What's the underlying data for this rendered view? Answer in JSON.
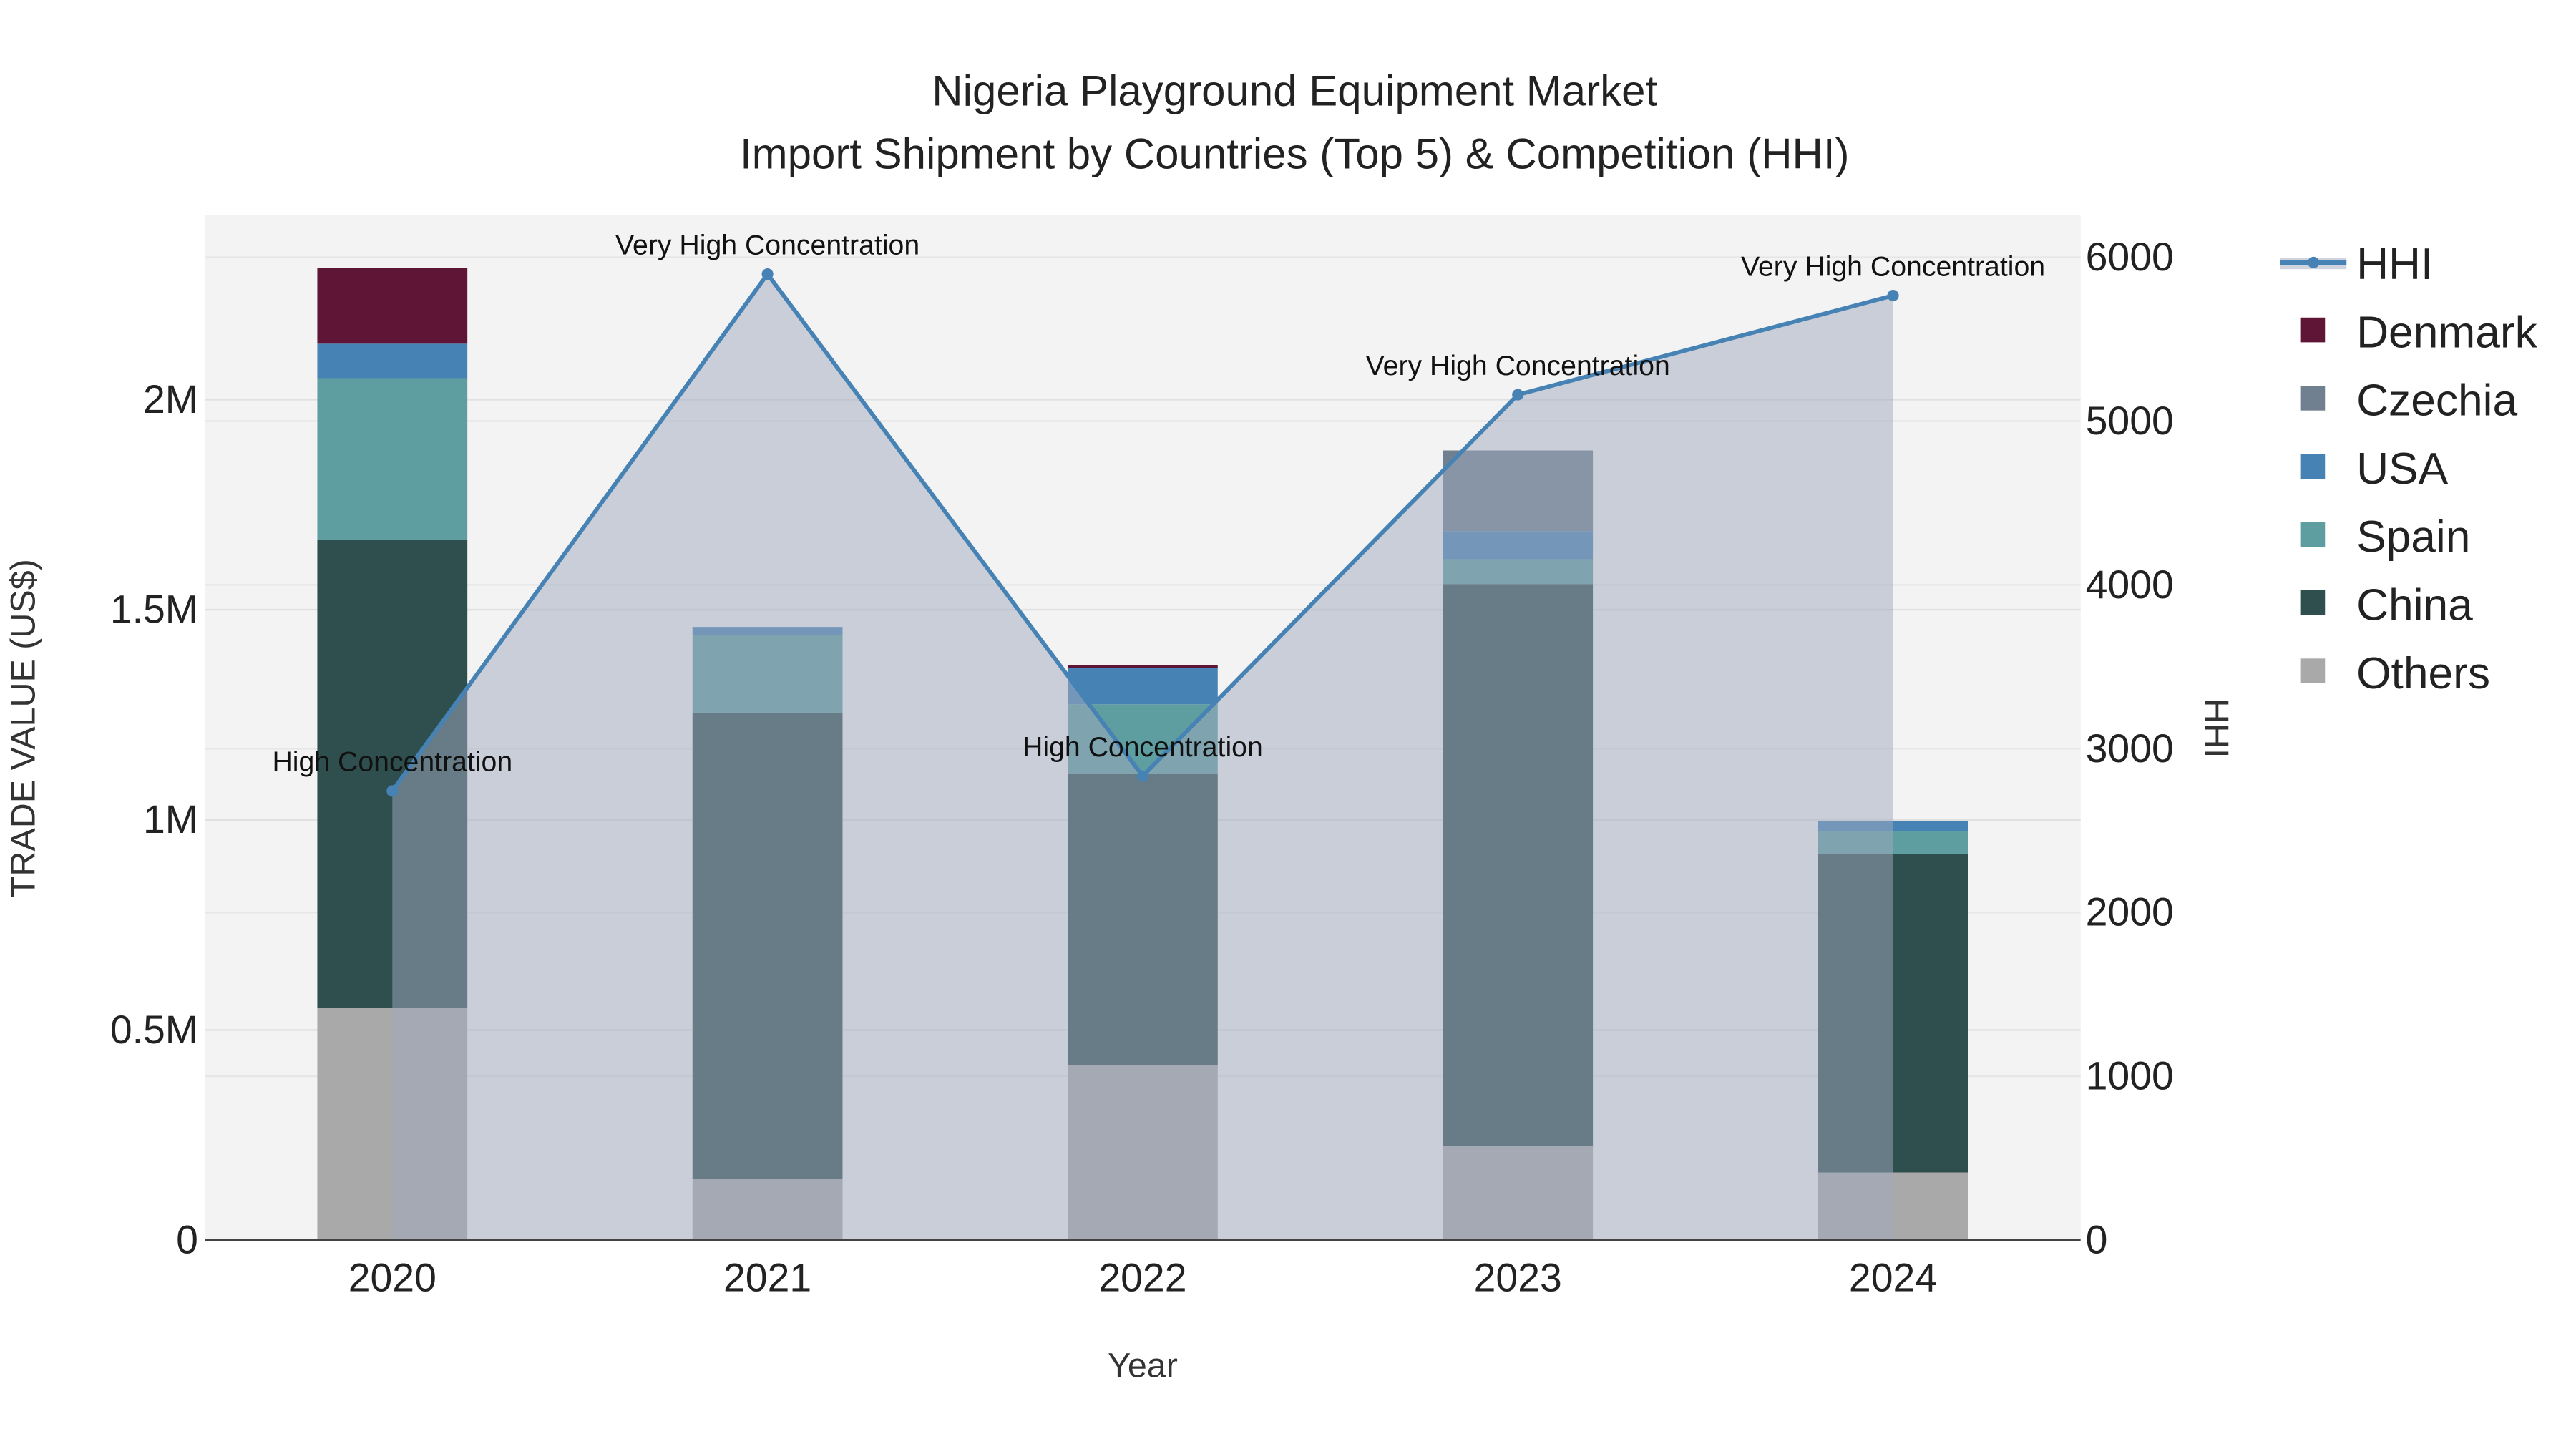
{
  "chart_data": {
    "type": "bar",
    "stacked": true,
    "title": "Nigeria Playground Equipment Market",
    "subtitle": "Import Shipment by Countries (Top 5) & Competition (HHI)",
    "xlabel": "Year",
    "ylabel": "TRADE VALUE (US$)",
    "y2label": "HHI",
    "categories": [
      "2020",
      "2021",
      "2022",
      "2023",
      "2024"
    ],
    "ylim": [
      0,
      2440000
    ],
    "y2lim": [
      0,
      6260
    ],
    "yticks": [
      {
        "v": 0,
        "label": "0"
      },
      {
        "v": 500000,
        "label": "0.5M"
      },
      {
        "v": 1000000,
        "label": "1M"
      },
      {
        "v": 1500000,
        "label": "1.5M"
      },
      {
        "v": 2000000,
        "label": "2M"
      }
    ],
    "y2ticks": [
      0,
      1000,
      2000,
      3000,
      4000,
      5000,
      6000
    ],
    "series": [
      {
        "name": "Others",
        "color": "#a9a9a9",
        "values": [
          553000,
          145000,
          416000,
          224000,
          161000
        ]
      },
      {
        "name": "China",
        "color": "#2f4f4f",
        "values": [
          1114000,
          1110000,
          694000,
          1337000,
          757000
        ]
      },
      {
        "name": "Spain",
        "color": "#5f9ea0",
        "values": [
          384000,
          184000,
          165000,
          59000,
          55000
        ]
      },
      {
        "name": "USA",
        "color": "#4682b4",
        "values": [
          82000,
          20000,
          86000,
          67000,
          24000
        ]
      },
      {
        "name": "Czechia",
        "color": "#708090",
        "values": [
          0,
          0,
          0,
          192000,
          0
        ]
      },
      {
        "name": "Denmark",
        "color": "#5f1535",
        "values": [
          180000,
          0,
          8000,
          0,
          0
        ]
      }
    ],
    "hhi": {
      "name": "HHI",
      "color": "#4682b4",
      "values": [
        2742,
        5897,
        2833,
        5161,
        5766
      ],
      "annotations": [
        "High Concentration",
        "Very High Concentration",
        "High Concentration",
        "Very High Concentration",
        "Very High Concentration"
      ]
    },
    "legend": [
      "HHI",
      "Denmark",
      "Czechia",
      "USA",
      "Spain",
      "China",
      "Others"
    ],
    "legend_placement": "right",
    "grid": true
  }
}
